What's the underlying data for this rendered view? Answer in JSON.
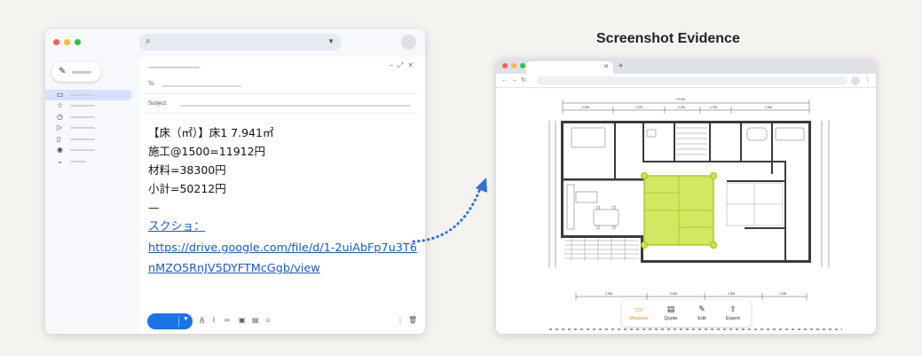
{
  "email": {
    "subject_label": "Subject:",
    "to_label": "To",
    "body_lines": [
      "【床（㎡）】床1 7.941㎡",
      "施工@1500=11912円",
      "材料=38300円",
      "小計=50212円",
      "—"
    ],
    "screenshot_label": "スクショ：",
    "link_text": "https://drive.google.com/file/d/1-2uiAbFp7u3T6nMZO5RnJV5DYFTMcGgb/view"
  },
  "evidence": {
    "title": "Screenshot Evidence"
  },
  "floorplan": {
    "top_total": "10,010",
    "top_dims": [
      "2,900",
      "1,375",
      "2,000",
      "1,790",
      "2,000"
    ],
    "bottom_dims": [
      "2,900",
      "2,900",
      "2,900",
      "1,200"
    ],
    "left_dims": [
      "4,850",
      "1,685",
      "1,200",
      "1,820",
      "1,820"
    ],
    "right_dims": [
      "6,500",
      "2,935",
      "1,465"
    ],
    "highlighted_room": "和室\n(7.5 畳)"
  },
  "toolbar": {
    "measure_label": "Measure",
    "quote_label": "Quote",
    "edit_label": "Edit",
    "export_label": "Export"
  },
  "colors": {
    "accent_blue": "#1a73e8",
    "highlight_green": "#c9e545",
    "measure_orange": "#e0902a"
  }
}
